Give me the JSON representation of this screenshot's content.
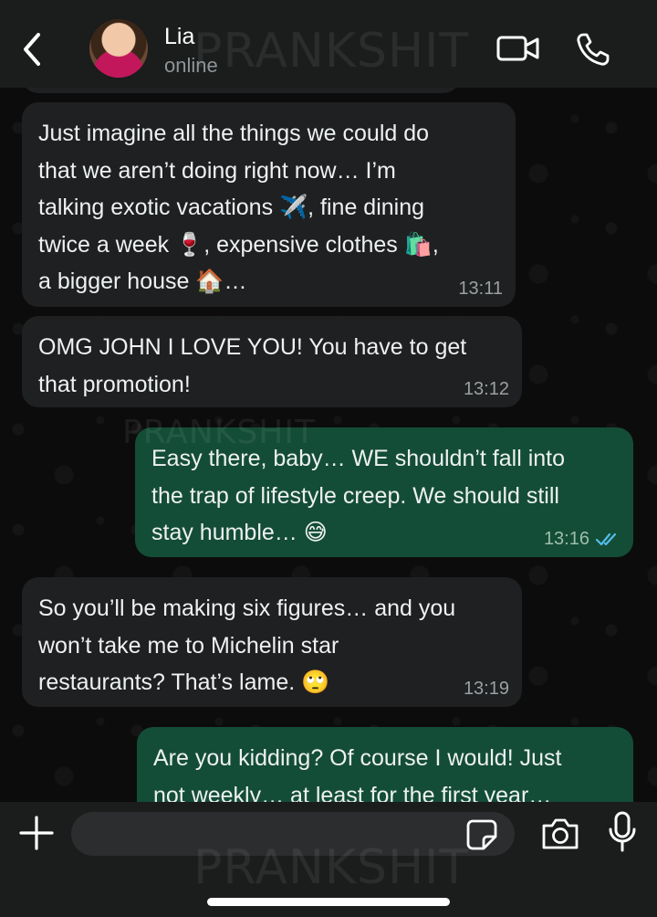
{
  "header": {
    "contact_name": "Lia",
    "status": "online",
    "watermark": "PRANKSHIT"
  },
  "messages": [
    {
      "direction": "incoming",
      "parts": [
        "Just imagine all the things we could do",
        "that we aren’t doing right now… I’m",
        "talking exotic vacations ✈️, fine dining",
        "twice a week 🍷, expensive clothes 🛍️,",
        "a bigger house 🏠…"
      ],
      "time": "13:11"
    },
    {
      "direction": "incoming",
      "parts": [
        "OMG JOHN I LOVE YOU! You have to get",
        "that promotion!"
      ],
      "time": "13:12"
    },
    {
      "direction": "outgoing",
      "parts": [
        "Easy there, baby… WE shouldn’t fall into",
        "the trap of lifestyle creep. We should still",
        "stay humble… 😅"
      ],
      "time": "13:16",
      "read": true
    },
    {
      "direction": "incoming",
      "parts": [
        "So you’ll be making six figures… and you",
        "won’t take me to Michelin star",
        "restaurants? That’s lame. 🙄"
      ],
      "time": "13:19"
    },
    {
      "direction": "outgoing",
      "parts": [
        "Are you kidding? Of course I would! Just",
        "not weekly… at least for the first year…"
      ],
      "time": ""
    }
  ],
  "composer": {
    "value": "",
    "placeholder": ""
  },
  "icons": {
    "back": "chevron-left-icon",
    "video": "video-camera-icon",
    "call": "phone-icon",
    "attach": "plus-icon",
    "sticker": "sticker-icon",
    "camera": "camera-icon",
    "mic": "microphone-icon"
  },
  "colors": {
    "incoming_bubble": "#1f2021",
    "outgoing_bubble": "#144d37",
    "read_ticks": "#53bdeb",
    "header_bg": "#1b1c1c"
  }
}
